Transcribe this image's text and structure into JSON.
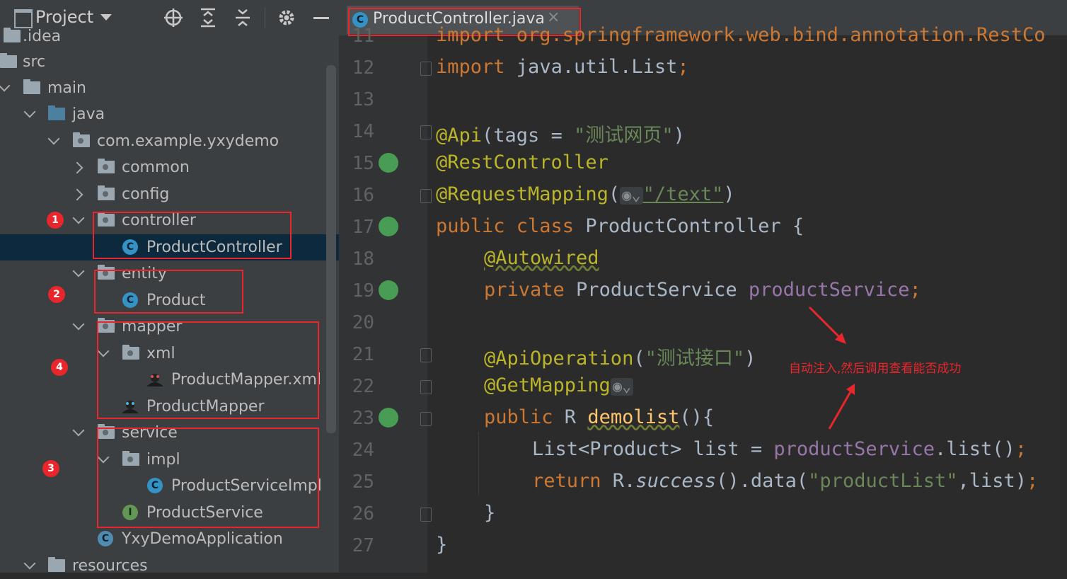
{
  "project_panel": {
    "title": "Project",
    "tree": [
      {
        "label": ".idea"
      },
      {
        "label": "src"
      },
      {
        "label": "main"
      },
      {
        "label": "java"
      },
      {
        "label": "com.example.yxydemo"
      },
      {
        "label": "common"
      },
      {
        "label": "config"
      },
      {
        "label": "controller"
      },
      {
        "label": "ProductController"
      },
      {
        "label": "entity"
      },
      {
        "label": "Product"
      },
      {
        "label": "mapper"
      },
      {
        "label": "xml"
      },
      {
        "label": "ProductMapper.xml"
      },
      {
        "label": "ProductMapper"
      },
      {
        "label": "service"
      },
      {
        "label": "impl"
      },
      {
        "label": "ProductServiceImpl"
      },
      {
        "label": "ProductService"
      },
      {
        "label": "YxyDemoApplication"
      },
      {
        "label": "resources"
      }
    ],
    "icon_letters": {
      "class": "C",
      "interface": "I"
    },
    "annotations": [
      "1",
      "2",
      "4",
      "3"
    ]
  },
  "editor": {
    "tab_label": "ProductController.java",
    "line_numbers": [
      "11",
      "12",
      "13",
      "14",
      "15",
      "16",
      "17",
      "18",
      "19",
      "20",
      "21",
      "22",
      "23",
      "24",
      "25",
      "26",
      "27"
    ],
    "lines": {
      "l11": "import org.springframework.web.bind.annotation.RestCo",
      "l12_kw": "import",
      "l12_rest": " java.util.List",
      "l12_semi": ";",
      "l14_an": "@Api",
      "l14_a": "(tags = ",
      "l14_str": "\"测试网页\"",
      "l14_b": ")",
      "l15": "@RestController",
      "l16_an": "@RequestMapping",
      "l16_a": "(",
      "l16_str": "\"/text\"",
      "l16_b": ")",
      "l17_kw": "public class",
      "l17_rest": " ProductController {",
      "l18": "@Autowired",
      "l19_kw": "private",
      "l19_type": " ProductService ",
      "l19_fld": "productService",
      "l19_semi": ";",
      "l21_an": "@ApiOperation",
      "l21_a": "(",
      "l21_str": "\"测试接口\"",
      "l21_b": ")",
      "l22": "@GetMapping",
      "l23_kw": "public",
      "l23_a": " R ",
      "l23_fn": "demolist",
      "l23_b": "(){",
      "l24_a": "List<Product> list = ",
      "l24_fld": "productService",
      "l24_b": ".list()",
      "l24_semi": ";",
      "l25_kw": "return",
      "l25_a": " R.",
      "l25_it": "success",
      "l25_b": "().data(",
      "l25_str": "\"productList\"",
      "l25_c": ",list)",
      "l25_semi": ";",
      "l26": "}",
      "l27": "}"
    },
    "note": "自动注入,然后调用查看能否成功"
  },
  "colors": {
    "keyword": "#cc7832",
    "annotation": "#bbb529",
    "string": "#6a8759",
    "field": "#9876aa",
    "highlight_box": "#e8262c"
  }
}
